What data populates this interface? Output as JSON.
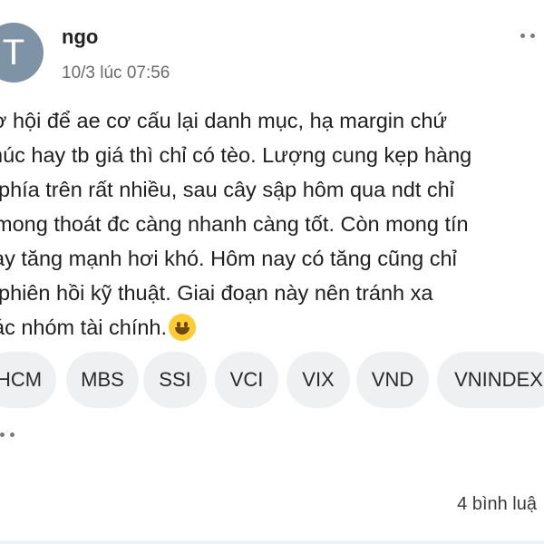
{
  "post": {
    "avatar_letter": "T",
    "author": "ngo",
    "timestamp": "10/3 lúc 07:56",
    "lines": [
      "ơ hội để ae cơ cấu lại danh mục, hạ margin chứ",
      "húc hay tb giá thì chỉ có tèo. Lượng cung kẹp hàng",
      "phía trên rất nhiều,  sau cây sập hôm qua ndt chỉ",
      "mong thoát đc càng nhanh càng tốt. Còn mong tín",
      "ay tăng mạnh hơi khó. Hôm nay có tăng cũng chỉ",
      " phiên hồi kỹ thuật. Giai đoạn này nên tránh xa",
      "ác nhóm tài chính."
    ],
    "emoji": "grinning-face",
    "tags": [
      "HCM",
      "MBS",
      "SSI",
      "VCI",
      "VIX",
      "VND",
      "VNINDEX"
    ],
    "comment_count": "4 bình luậ"
  },
  "colors": {
    "avatar_bg": "#7f93a6",
    "tag_bg": "#eef0f2",
    "text": "#202020",
    "muted": "#6a6a6a"
  }
}
